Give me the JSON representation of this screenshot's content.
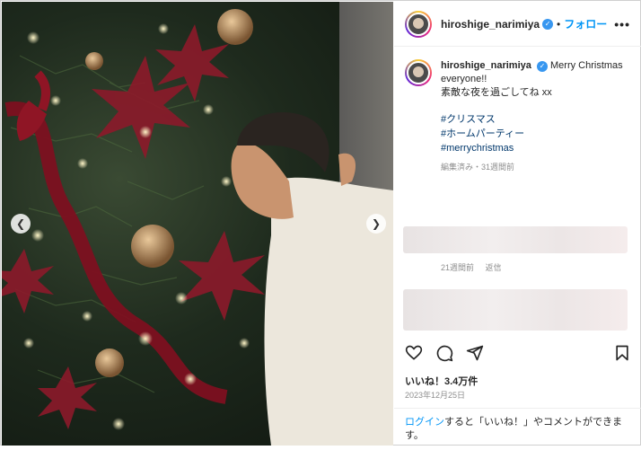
{
  "post": {
    "username": "hiroshige_narimiya",
    "follow_label": "フォロー",
    "more_label": "•••",
    "caption_line1": "Merry Christmas everyone!!",
    "caption_line2": "素敵な夜を過ごしてね xx",
    "hashtags": [
      "#クリスマス",
      "#ホームパーティー",
      "#merrychristmas"
    ],
    "edited_label": "編集済み・31週間前",
    "add_comment_glyph": "+",
    "comment_time": "21週間前",
    "comment_reply": "返信",
    "likes": "いいね！3.4万件",
    "date": "2023年12月25日",
    "login_link": "ログイン",
    "login_text": "すると「いいね！」やコメントができます。"
  },
  "icons": {
    "verified": "verified-badge-icon",
    "heart": "heart-icon",
    "comment": "comment-icon",
    "share": "share-icon",
    "bookmark": "bookmark-icon",
    "prev": "chevron-left-icon",
    "next": "chevron-right-icon",
    "add": "plus-circle-icon"
  },
  "colors": {
    "accent": "#0095f6",
    "verified": "#3897f0",
    "hashtag": "#00376b",
    "muted": "#8e8e8e"
  }
}
